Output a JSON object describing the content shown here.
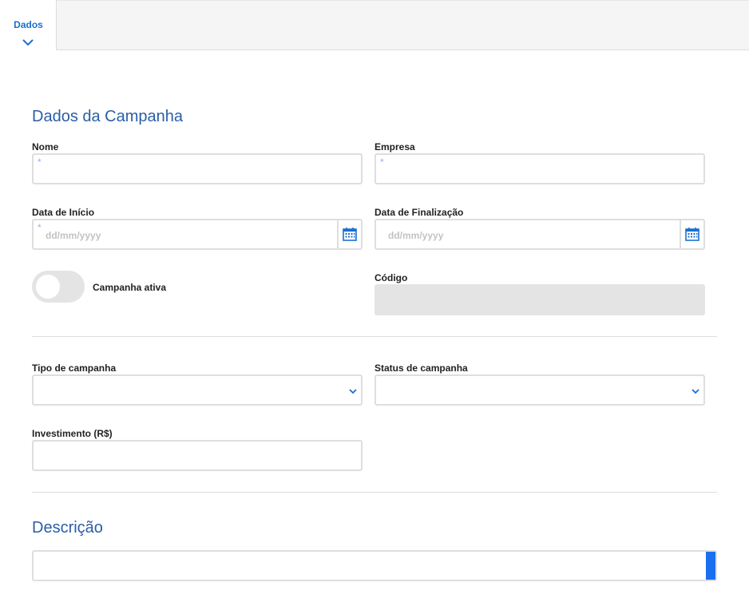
{
  "tabs": [
    {
      "label": "Dados",
      "active": true
    }
  ],
  "section_main": {
    "title": "Dados da Campanha"
  },
  "fields": {
    "nome": {
      "label": "Nome",
      "required_mark": "*",
      "value": ""
    },
    "empresa": {
      "label": "Empresa",
      "required_mark": "*",
      "value": ""
    },
    "data_inicio": {
      "label": "Data de Início",
      "required_mark": "*",
      "placeholder": "dd/mm/yyyy"
    },
    "data_finalizacao": {
      "label": "Data de Finalização",
      "placeholder": "dd/mm/yyyy"
    },
    "campanha_ativa": {
      "label": "Campanha ativa",
      "checked": false
    },
    "codigo": {
      "label": "Código",
      "value": "",
      "disabled": true
    },
    "tipo_campanha": {
      "label": "Tipo de campanha",
      "value": ""
    },
    "status_campanha": {
      "label": "Status de campanha",
      "value": ""
    },
    "investimento": {
      "label": "Investimento (R$)",
      "value": ""
    }
  },
  "section_desc": {
    "title": "Descrição"
  },
  "colors": {
    "accent": "#1a6fd1",
    "section_title": "#2a5ea6",
    "border": "#dedede",
    "disabled_bg": "#e4e4e4",
    "scroll_bar": "#1a6ff0"
  },
  "icons": {
    "tab_chevron": "chevron-down-icon",
    "calendar": "calendar-icon",
    "select_chevron": "chevron-down-icon"
  }
}
